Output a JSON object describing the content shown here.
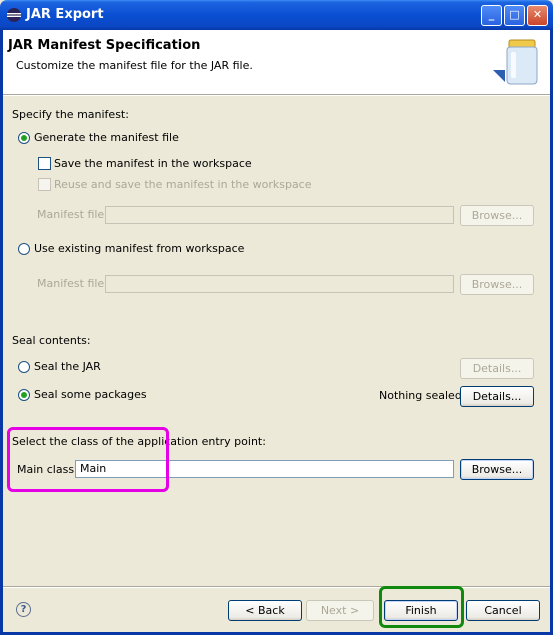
{
  "window": {
    "title": "JAR Export",
    "controls": {
      "minimize": "_",
      "maximize": "□",
      "close": "✕"
    }
  },
  "header": {
    "title": "JAR Manifest Specification",
    "subtitle": "Customize the manifest file for the JAR file."
  },
  "manifest": {
    "section_label": "Specify the manifest:",
    "generate_label": "Generate the manifest file",
    "generate_selected": true,
    "save_in_workspace_label": "Save the manifest in the workspace",
    "reuse_label": "Reuse and save the manifest in the workspace",
    "manifest_file_label_1": "Manifest file:",
    "manifest_file_value_1": "",
    "browse_1": "Browse...",
    "use_existing_label": "Use existing manifest from workspace",
    "manifest_file_label_2": "Manifest file:",
    "manifest_file_value_2": "",
    "browse_2": "Browse..."
  },
  "seal": {
    "section_label": "Seal contents:",
    "seal_jar_label": "Seal the JAR",
    "details_1": "Details...",
    "seal_packages_label": "Seal some packages",
    "status": "Nothing sealed",
    "details_2": "Details..."
  },
  "entry": {
    "section_label": "Select the class of the application entry point:",
    "main_class_label": "Main class:",
    "main_class_value": "Main",
    "browse": "Browse..."
  },
  "footer": {
    "help": "?",
    "back": "< Back",
    "next": "Next >",
    "finish": "Finish",
    "cancel": "Cancel"
  },
  "colors": {
    "titlebar": "#0a4fd2",
    "annotation_magenta": "#e600e6",
    "annotation_green": "#0f8a0f"
  }
}
